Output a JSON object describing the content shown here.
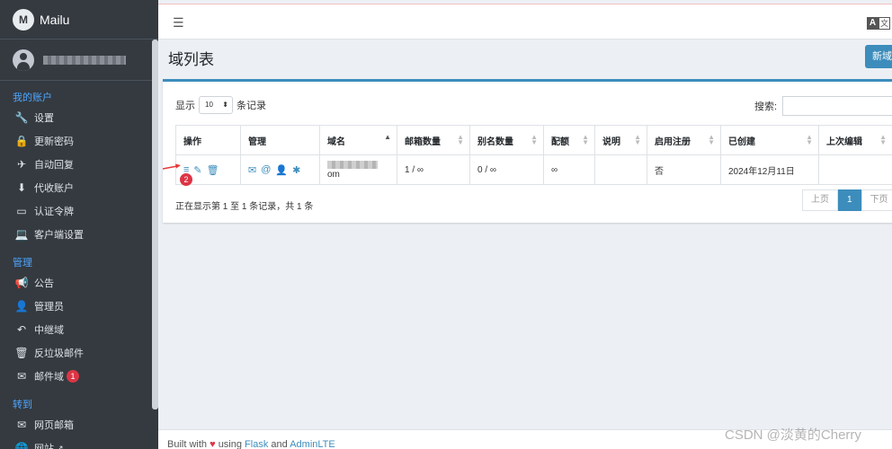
{
  "brand": {
    "name": "Mailu",
    "logo": "M"
  },
  "topbar": {
    "menu_icon": "☰",
    "lang_a": "A",
    "lang_b": "文"
  },
  "sidebar": {
    "sections": [
      {
        "header": "我的账户",
        "items": [
          {
            "label": "设置",
            "icon": "🔧"
          },
          {
            "label": "更新密码",
            "icon": "🔒"
          },
          {
            "label": "自动回复",
            "icon": "✈"
          },
          {
            "label": "代收账户",
            "icon": "⬇"
          },
          {
            "label": "认证令牌",
            "icon": "▭"
          },
          {
            "label": "客户端设置",
            "icon": "💻"
          }
        ]
      },
      {
        "header": "管理",
        "items": [
          {
            "label": "公告",
            "icon": "📢"
          },
          {
            "label": "管理员",
            "icon": "👤"
          },
          {
            "label": "中继域",
            "icon": "↶"
          },
          {
            "label": "反垃圾邮件",
            "icon": "🗑"
          },
          {
            "label": "邮件域",
            "icon": "✉",
            "badge": "1"
          }
        ]
      },
      {
        "header": "转到",
        "items": [
          {
            "label": "网页邮箱",
            "icon": "✉"
          },
          {
            "label": "网站",
            "icon": "🌐",
            "suffix": "↗"
          }
        ]
      }
    ]
  },
  "page": {
    "title": "域列表",
    "new_button": "新域"
  },
  "table_controls": {
    "show_prefix": "显示",
    "page_size": "10",
    "show_suffix": "条记录",
    "search_label": "搜索:"
  },
  "table": {
    "headers": [
      "操作",
      "管理",
      "域名",
      "邮箱数量",
      "别名数量",
      "配额",
      "说明",
      "启用注册",
      "已创建",
      "上次编辑"
    ],
    "rows": [
      {
        "domain_suffix": "om",
        "mailbox_count": "1 / ∞",
        "alias_count": "0 / ∞",
        "quota": "∞",
        "comment": "",
        "signup": "否",
        "created": "2024年12月11日",
        "updated": ""
      }
    ]
  },
  "row_icons": {
    "ops": [
      "≡",
      "✎",
      "🗑"
    ],
    "manage": [
      "✉",
      "@",
      "👤",
      "✱"
    ]
  },
  "table_info": "正在显示第 1 至 1 条记录，共 1 条",
  "pagination": {
    "prev": "上页",
    "current": "1",
    "next": "下页"
  },
  "annotation": {
    "step": "2"
  },
  "footer": {
    "built_with": "Built with",
    "using": "using",
    "flask": "Flask",
    "and": "and",
    "adminlte": "AdminLTE"
  },
  "watermark": "CSDN @淡黄的Cherry",
  "colors": {
    "sidebar": "#343a40",
    "accent": "#3c8dbc",
    "nav_header": "#4ea6ff",
    "badge": "#dc3545"
  }
}
